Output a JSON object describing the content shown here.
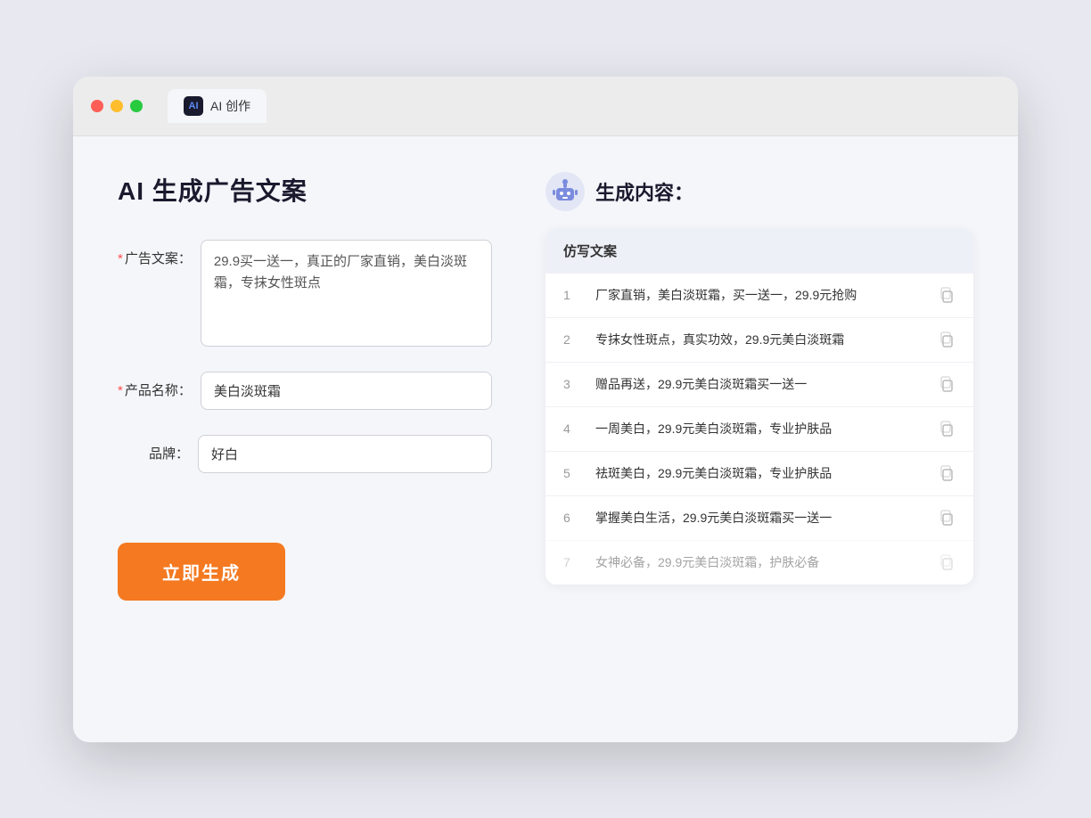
{
  "browser": {
    "tab_label": "AI 创作"
  },
  "page": {
    "title": "AI 生成广告文案",
    "result_title": "生成内容："
  },
  "form": {
    "ad_copy_label": "广告文案：",
    "ad_copy_required": "*",
    "ad_copy_value": "29.9买一送一，真正的厂家直销，美白淡斑霜，专抹女性斑点",
    "product_name_label": "产品名称：",
    "product_name_required": "*",
    "product_name_value": "美白淡斑霜",
    "brand_label": "品牌：",
    "brand_value": "好白",
    "generate_button": "立即生成"
  },
  "results": {
    "table_header": "仿写文案",
    "items": [
      {
        "num": "1",
        "text": "厂家直销，美白淡斑霜，买一送一，29.9元抢购"
      },
      {
        "num": "2",
        "text": "专抹女性斑点，真实功效，29.9元美白淡斑霜"
      },
      {
        "num": "3",
        "text": "赠品再送，29.9元美白淡斑霜买一送一"
      },
      {
        "num": "4",
        "text": "一周美白，29.9元美白淡斑霜，专业护肤品"
      },
      {
        "num": "5",
        "text": "祛斑美白，29.9元美白淡斑霜，专业护肤品"
      },
      {
        "num": "6",
        "text": "掌握美白生活，29.9元美白淡斑霜买一送一"
      },
      {
        "num": "7",
        "text": "女神必备，29.9元美白淡斑霜，护肤必备"
      }
    ]
  }
}
